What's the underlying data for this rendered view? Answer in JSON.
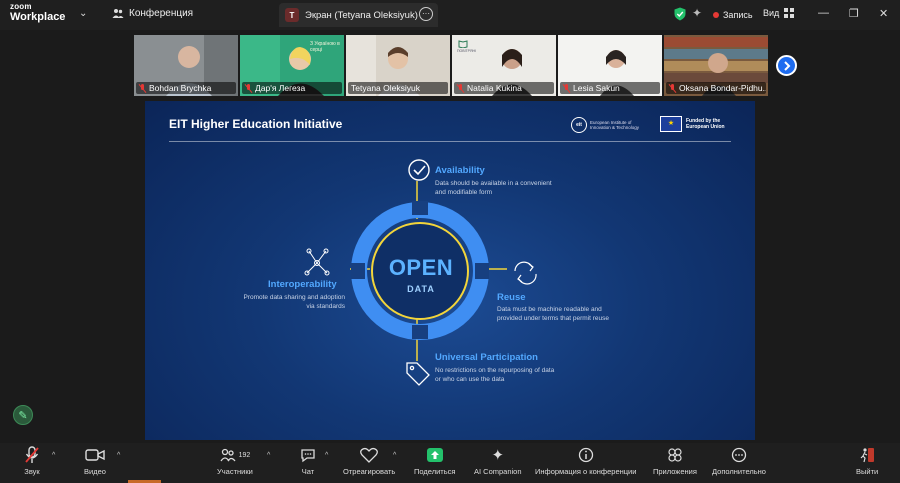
{
  "app": {
    "brand_top": "zoom",
    "brand_bottom": "Workplace",
    "conference_label": "Конференция",
    "tab_badge": "T",
    "tab_title": "Экран (Tetyana Oleksiyuk)",
    "tab_more": "···",
    "record_label": "Запись",
    "view_label": "Вид",
    "win_min": "—",
    "win_restore": "❐",
    "win_close": "✕"
  },
  "participants": [
    {
      "name": "Bohdan Brychka",
      "muted": true,
      "bg": "#7f8488"
    },
    {
      "name": "Дар'я Легеза",
      "muted": true,
      "bg": "#2fa57a"
    },
    {
      "name": "Tetyana Oleksiyuk",
      "muted": false,
      "bg": "#d8d2c7"
    },
    {
      "name": "Natalia Kukina",
      "muted": true,
      "bg": "#e9e6e2"
    },
    {
      "name": "Lesia Sakun",
      "muted": true,
      "bg": "#f2f2f0"
    },
    {
      "name": "Oksana Bondar-Pidhu...",
      "muted": true,
      "bg": "#7a5a3e"
    }
  ],
  "thumb_overlay_text": {
    "p2": "З Україною в серці",
    "p4": "ПОВІТРЯНІ"
  },
  "slide": {
    "title": "EIT Higher Education Initiative",
    "eit_logo": "eit",
    "eit_text": "European Institute of Innovation & Technology",
    "eu_text": "Funded by the European Union",
    "center_big": "OPEN",
    "center_small": "DATA",
    "availability_title": "Availability",
    "availability_text_1": "Data should be available in a convenient",
    "availability_text_2": "and modifiable form",
    "interop_title": "Interoperability",
    "interop_text_1": "Promote data sharing and adoption",
    "interop_text_2": "via standards",
    "reuse_title": "Reuse",
    "reuse_text_1": "Data must be machine readable and",
    "reuse_text_2": "provided under terms that permit reuse",
    "universal_title": "Universal Participation",
    "universal_text_1": "No restrictions on the repurposing of data",
    "universal_text_2": "or who can use the data"
  },
  "toolbar": {
    "audio": "Звук",
    "video": "Видео",
    "participants": "Участники",
    "participant_count": "192",
    "chat": "Чат",
    "react": "Отреагировать",
    "share": "Поделиться",
    "ai": "AI Companion",
    "info": "Информация о конференции",
    "apps": "Приложения",
    "more": "Дополнительно",
    "leave": "Выйти"
  },
  "colors": {
    "accent_blue": "#1e6cf0",
    "active_green": "#23c16b",
    "record_red": "#e53935",
    "slide_accent": "#52a8ff",
    "ring_yellow": "#f3d53a"
  }
}
